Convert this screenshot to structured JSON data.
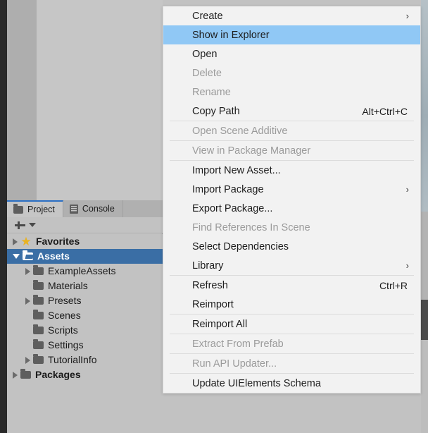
{
  "colors": {
    "menu_bg": "#f2f2f2",
    "menu_highlight": "#90c8f5",
    "tree_selection": "#3a6ea5",
    "panel_bg": "#c2c2c2",
    "tab_active_accent": "#2b6fc4",
    "star_gold": "#e8b222",
    "disabled_text": "#9b9b9b"
  },
  "project_panel": {
    "tabs": [
      {
        "label": "Project",
        "icon": "folder-icon",
        "active": true
      },
      {
        "label": "Console",
        "icon": "console-icon",
        "active": false
      }
    ],
    "toolbar": {
      "add_label": "+",
      "add_icon": "plus-icon",
      "dropdown_icon": "caret-down-icon"
    },
    "tree": [
      {
        "label": "Favorites",
        "icon": "star-icon",
        "indent": 0,
        "arrow": "collapsed",
        "bold": true,
        "selected": false
      },
      {
        "label": "Assets",
        "icon": "folder-open-icon",
        "indent": 0,
        "arrow": "expanded",
        "bold": true,
        "selected": true
      },
      {
        "label": "ExampleAssets",
        "icon": "folder-icon",
        "indent": 1,
        "arrow": "collapsed",
        "bold": false,
        "selected": false
      },
      {
        "label": "Materials",
        "icon": "folder-icon",
        "indent": 1,
        "arrow": "none",
        "bold": false,
        "selected": false
      },
      {
        "label": "Presets",
        "icon": "folder-icon",
        "indent": 1,
        "arrow": "collapsed",
        "bold": false,
        "selected": false
      },
      {
        "label": "Scenes",
        "icon": "folder-icon",
        "indent": 1,
        "arrow": "none",
        "bold": false,
        "selected": false
      },
      {
        "label": "Scripts",
        "icon": "folder-icon",
        "indent": 1,
        "arrow": "none",
        "bold": false,
        "selected": false
      },
      {
        "label": "Settings",
        "icon": "folder-icon",
        "indent": 1,
        "arrow": "none",
        "bold": false,
        "selected": false
      },
      {
        "label": "TutorialInfo",
        "icon": "folder-icon",
        "indent": 1,
        "arrow": "collapsed",
        "bold": false,
        "selected": false
      },
      {
        "label": "Packages",
        "icon": "folder-icon",
        "indent": 0,
        "arrow": "collapsed",
        "bold": true,
        "selected": false
      }
    ]
  },
  "context_menu": {
    "items": [
      {
        "kind": "item",
        "label": "Create",
        "shortcut": "",
        "submenu": true,
        "disabled": false,
        "highlighted": false
      },
      {
        "kind": "item",
        "label": "Show in Explorer",
        "shortcut": "",
        "submenu": false,
        "disabled": false,
        "highlighted": true
      },
      {
        "kind": "item",
        "label": "Open",
        "shortcut": "",
        "submenu": false,
        "disabled": false,
        "highlighted": false
      },
      {
        "kind": "item",
        "label": "Delete",
        "shortcut": "",
        "submenu": false,
        "disabled": true,
        "highlighted": false
      },
      {
        "kind": "item",
        "label": "Rename",
        "shortcut": "",
        "submenu": false,
        "disabled": true,
        "highlighted": false
      },
      {
        "kind": "item",
        "label": "Copy Path",
        "shortcut": "Alt+Ctrl+C",
        "submenu": false,
        "disabled": false,
        "highlighted": false
      },
      {
        "kind": "separator"
      },
      {
        "kind": "item",
        "label": "Open Scene Additive",
        "shortcut": "",
        "submenu": false,
        "disabled": true,
        "highlighted": false
      },
      {
        "kind": "separator"
      },
      {
        "kind": "item",
        "label": "View in Package Manager",
        "shortcut": "",
        "submenu": false,
        "disabled": true,
        "highlighted": false
      },
      {
        "kind": "separator"
      },
      {
        "kind": "item",
        "label": "Import New Asset...",
        "shortcut": "",
        "submenu": false,
        "disabled": false,
        "highlighted": false
      },
      {
        "kind": "item",
        "label": "Import Package",
        "shortcut": "",
        "submenu": true,
        "disabled": false,
        "highlighted": false
      },
      {
        "kind": "item",
        "label": "Export Package...",
        "shortcut": "",
        "submenu": false,
        "disabled": false,
        "highlighted": false
      },
      {
        "kind": "item",
        "label": "Find References In Scene",
        "shortcut": "",
        "submenu": false,
        "disabled": true,
        "highlighted": false
      },
      {
        "kind": "item",
        "label": "Select Dependencies",
        "shortcut": "",
        "submenu": false,
        "disabled": false,
        "highlighted": false
      },
      {
        "kind": "item",
        "label": "Library",
        "shortcut": "",
        "submenu": true,
        "disabled": false,
        "highlighted": false
      },
      {
        "kind": "separator"
      },
      {
        "kind": "item",
        "label": "Refresh",
        "shortcut": "Ctrl+R",
        "submenu": false,
        "disabled": false,
        "highlighted": false
      },
      {
        "kind": "item",
        "label": "Reimport",
        "shortcut": "",
        "submenu": false,
        "disabled": false,
        "highlighted": false
      },
      {
        "kind": "separator"
      },
      {
        "kind": "item",
        "label": "Reimport All",
        "shortcut": "",
        "submenu": false,
        "disabled": false,
        "highlighted": false
      },
      {
        "kind": "separator"
      },
      {
        "kind": "item",
        "label": "Extract From Prefab",
        "shortcut": "",
        "submenu": false,
        "disabled": true,
        "highlighted": false
      },
      {
        "kind": "separator"
      },
      {
        "kind": "item",
        "label": "Run API Updater...",
        "shortcut": "",
        "submenu": false,
        "disabled": true,
        "highlighted": false
      },
      {
        "kind": "separator"
      },
      {
        "kind": "item",
        "label": "Update UIElements Schema",
        "shortcut": "",
        "submenu": false,
        "disabled": false,
        "highlighted": false
      }
    ],
    "submenu_glyph": "›"
  }
}
